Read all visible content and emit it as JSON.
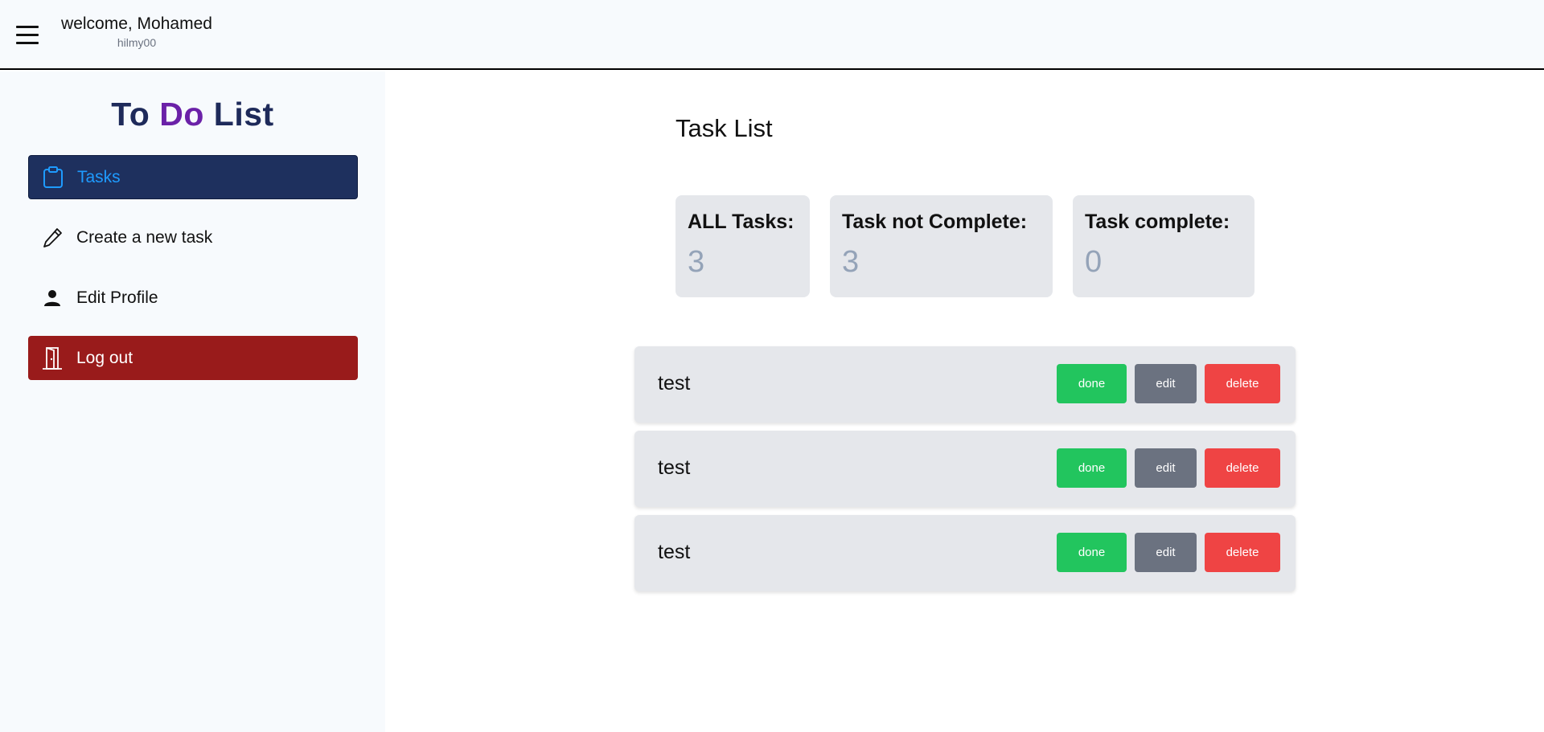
{
  "header": {
    "welcome_text": "welcome, Mohamed",
    "username": "hilmy00"
  },
  "sidebar": {
    "brand": {
      "part1": "To",
      "part2": "Do",
      "part3": "List"
    },
    "items": [
      {
        "label": "Tasks",
        "icon": "clipboard-icon",
        "active": true
      },
      {
        "label": "Create a new task",
        "icon": "pencil-icon"
      },
      {
        "label": "Edit Profile",
        "icon": "user-icon"
      },
      {
        "label": "Log out",
        "icon": "door-icon"
      }
    ]
  },
  "main": {
    "title": "Task List",
    "stats": [
      {
        "label": "ALL Tasks:",
        "value": "3"
      },
      {
        "label": "Task not Complete:",
        "value": "3"
      },
      {
        "label": "Task complete:",
        "value": "0"
      }
    ],
    "tasks": [
      {
        "name": "test",
        "done_label": "done",
        "edit_label": "edit",
        "delete_label": "delete"
      },
      {
        "name": "test",
        "done_label": "done",
        "edit_label": "edit",
        "delete_label": "delete"
      },
      {
        "name": "test",
        "done_label": "done",
        "edit_label": "edit",
        "delete_label": "delete"
      }
    ]
  },
  "colors": {
    "sidebar_bg": "#f7fafd",
    "active_nav_bg": "#1e305e",
    "active_nav_text": "#1e9bff",
    "logout_bg": "#991b1b",
    "brand_accent": "#6b21a8",
    "done": "#22c55e",
    "edit": "#6b7280",
    "delete": "#ef4444"
  }
}
